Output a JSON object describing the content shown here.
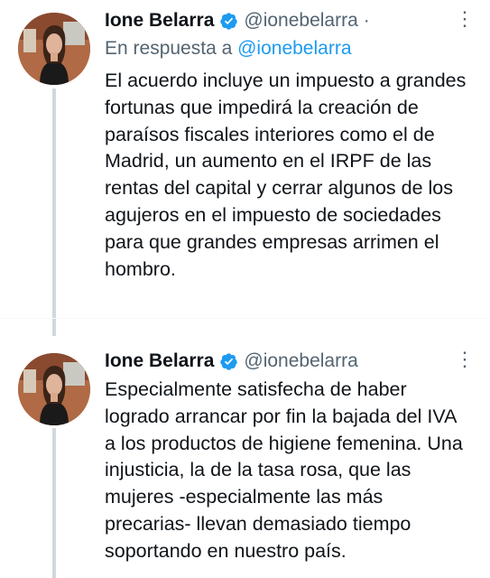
{
  "tweets": [
    {
      "author_name": "Ione Belarra",
      "handle": "@ionebelarra",
      "separator": "·",
      "reply_prefix": "En respuesta a",
      "reply_to": "@ionebelarra",
      "text": "El acuerdo incluye un impuesto a grandes fortunas que impedirá la creación de paraísos fiscales interiores como el de Madrid, un aumento en el IRPF de las rentas del capital y cerrar algunos de los agujeros en el impuesto de sociedades para que grandes empresas arrimen el hombro."
    },
    {
      "author_name": "Ione Belarra",
      "handle": "@ionebelarra",
      "text": "Especialmente satisfecha de haber logrado arrancar por fin la bajada del IVA a los productos de higiene femenina. Una injusticia, la de la tasa rosa, que las mujeres -especialmente las más precarias- llevan demasiado tiempo soportando en nuestro país."
    }
  ],
  "icons": {
    "verified": "verified-badge-icon",
    "more": "more-options-icon"
  },
  "colors": {
    "accent": "#1d9bf0",
    "text": "#0f1419",
    "secondary": "#536471",
    "thread_line": "#cfd9de"
  }
}
